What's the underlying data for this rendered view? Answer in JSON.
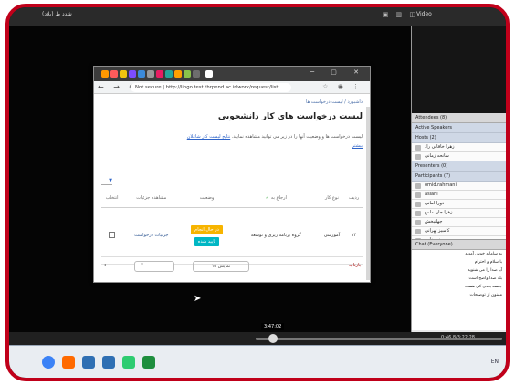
{
  "window": {
    "app_title": "(بلاد) شدد ط",
    "video_title": "Video"
  },
  "browser": {
    "url": "Not secure | http://lingo.test.thrpend.ac.ir/work/request/list"
  },
  "page": {
    "breadcrumb": "داشبورد / لیست درخواست ها",
    "title": "لیست درخواست های کار دانشجویی",
    "description": "لیست درخواست ها و وضعیت آنها را در زیر می توانید مشاهده نمایید.",
    "description_link": "نتایج لیست کار شاغلان",
    "more_link": "بیشتر"
  },
  "table": {
    "headers": [
      "ردیف",
      "نوع کار",
      "ارجاع به",
      "وضعیت",
      "مشاهده جزئیات",
      "انتخاب"
    ],
    "rows": [
      {
        "index": "۱۴",
        "work_type": "آموزشی",
        "assigned_to": "گروه برنامه ریزی و توسعه",
        "status": "در حال انجام",
        "status_secondary": "تایید شده",
        "details": "جزئیات درخواست"
      }
    ]
  },
  "footer": {
    "pager_label": "نمایش ۱۵",
    "right_tag": "بازتاب"
  },
  "sidebar": {
    "attendees_label": "Attendees (8)",
    "active_speakers": "Active Speakers",
    "hosts_label": "Hosts (2)",
    "hosts": [
      "زهرا خاقانی راد",
      "سانحه زمانی"
    ],
    "presenters_label": "Presenters (0)",
    "participants_label": "Participants (7)",
    "participants": [
      "omid.rahmani",
      "aslani",
      "دورا امانی",
      "زهرا جان ملمع",
      "جهانبخش",
      "کامبیز تهرانی",
      "احمد رضایی"
    ],
    "chat_label": "Chat (Everyone)",
    "chat_lines": [
      "به سامانه خوش آمدید",
      "با سلام و احترام",
      "آیا صدا را می شنوید",
      "بله صدا واضح است",
      "جلسه بعدی کی هست",
      "ممنون از توضیحات"
    ]
  },
  "player": {
    "current_time": "3:47:02",
    "elapsed": "0:46 8/3:22:28"
  },
  "taskbar": {
    "clock": "EN"
  }
}
